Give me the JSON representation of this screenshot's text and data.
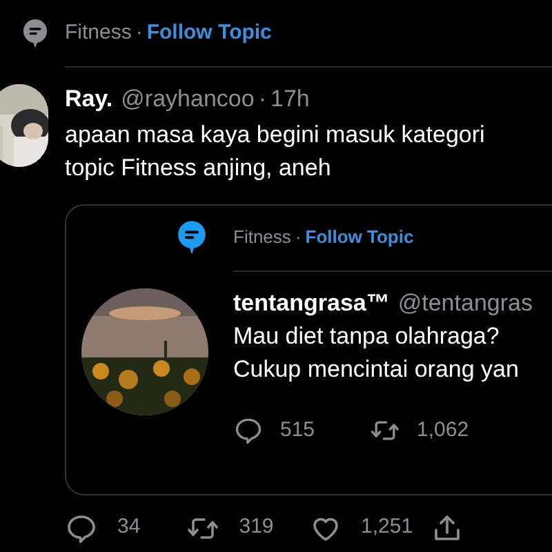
{
  "topic": {
    "name": "Fitness",
    "separator": "·",
    "action": "Follow Topic"
  },
  "tweet": {
    "display_name": "Ray.",
    "handle": "@rayhancoo",
    "separator": "·",
    "time": "17h",
    "text": "apaan masa kaya begini masuk kategori topic Fitness anjing, aneh",
    "quote": {
      "topic": {
        "name": "Fitness",
        "separator": "·",
        "action": "Follow Topic"
      },
      "display_name": "tentangrasa™",
      "handle": "@tentangras",
      "lines": [
        "Mau diet tanpa olahraga?",
        "Cukup mencintai orang yan"
      ],
      "actions": [
        {
          "kind": "reply",
          "count": "515"
        },
        {
          "kind": "retweet",
          "count": "1,062"
        }
      ]
    },
    "actions": [
      {
        "kind": "reply",
        "count": "34"
      },
      {
        "kind": "retweet",
        "count": "319"
      },
      {
        "kind": "like",
        "count": "1,251"
      },
      {
        "kind": "share"
      }
    ]
  }
}
